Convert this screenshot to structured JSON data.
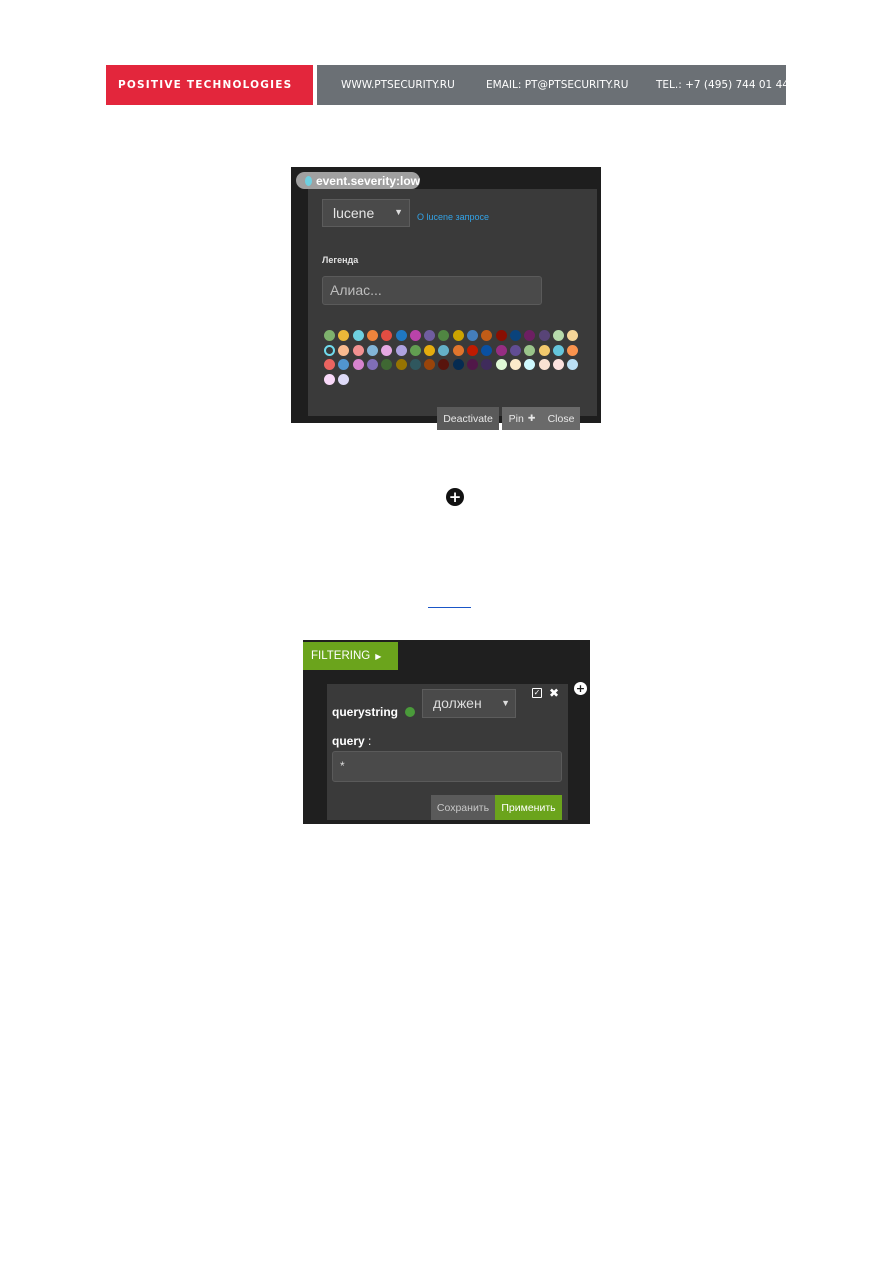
{
  "header": {
    "brand": "POSITIVE TECHNOLOGIES",
    "website": "WWW.PTSECURITY.RU",
    "email": "EMAIL: PT@PTSECURITY.RU",
    "phone": "TEL.: +7 (495) 744 01 44",
    "brand_color": "#e3263c",
    "bar_color": "#6b7075"
  },
  "query_popup": {
    "tag_label": "event.severity:low",
    "tag_dot_color": "#6ed0e0",
    "query_type": "lucene",
    "help_link": "О lucene запросе",
    "legend_label": "Легенда",
    "alias_placeholder": "Алиас...",
    "palette": [
      "#7eb26d",
      "#eab839",
      "#6ed0e0",
      "#ef843c",
      "#e24d42",
      "#1f78c1",
      "#ba43a9",
      "#705da0",
      "#508642",
      "#cca300",
      "#447ebc",
      "#c15c17",
      "#890f02",
      "#0a437c",
      "#6d1f62",
      "#584477",
      "#b7dbab",
      "#f4d598",
      "#70dbed",
      "#f9ba8f",
      "#f29191",
      "#82b5d8",
      "#e5a8e2",
      "#aea2e0",
      "#629e51",
      "#e5ac0e",
      "#64b0c8",
      "#e0752d",
      "#bf1b00",
      "#0a50a1",
      "#962d82",
      "#614d93",
      "#9ac48a",
      "#f2c96d",
      "#65c5db",
      "#f9934e",
      "#ea6460",
      "#5195ce",
      "#d683ce",
      "#806eb7",
      "#3f6833",
      "#967302",
      "#2f575e",
      "#99440a",
      "#58140c",
      "#052b51",
      "#511749",
      "#3f2b5b",
      "#e0f9d7",
      "#fceaca",
      "#cffaff",
      "#f9e2d2",
      "#fce2de",
      "#badff4",
      "#f9d9f9",
      "#dedaf7"
    ],
    "selected_color_index": 18,
    "buttons": {
      "deactivate": "Deactivate",
      "pin": "Pin",
      "close": "Close"
    }
  },
  "filtering_panel": {
    "title": "FILTERING",
    "filter_type": "querystring",
    "status_dot_color": "#4a9a3a",
    "mode": "должен",
    "query_label": "query",
    "query_colon": ":",
    "query_value": "*",
    "buttons": {
      "save": "Сохранить",
      "apply": "Применить"
    },
    "accent_color": "#6ba41c"
  },
  "icons": {
    "add_panel": "plus-circle-icon",
    "add_filter": "plus-circle-icon",
    "toggle": "check-square-icon",
    "remove": "close-icon",
    "pin": "pushpin-icon"
  }
}
